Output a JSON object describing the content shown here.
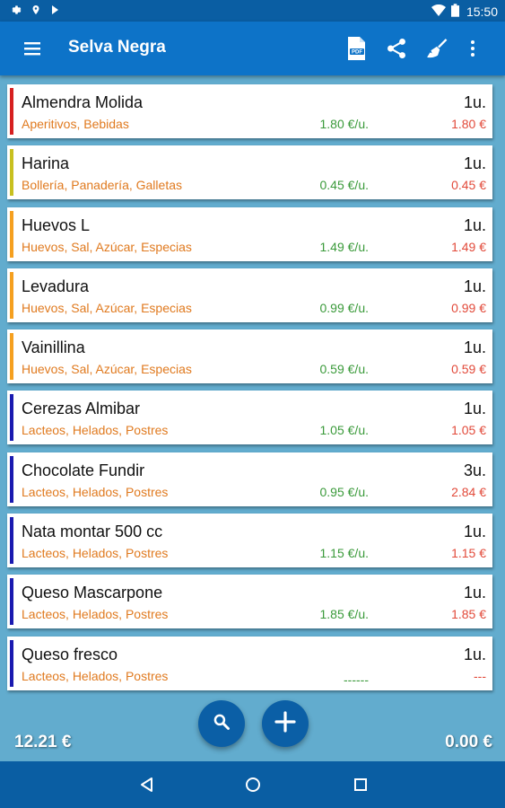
{
  "status_bar": {
    "time": "15:50",
    "icons": [
      "settings-gear-icon",
      "location-icon",
      "play-store-icon",
      "wifi-icon",
      "battery-icon"
    ]
  },
  "app_bar": {
    "title": "Selva Negra",
    "actions": [
      "pdf-icon",
      "share-icon",
      "broom-clean-icon",
      "more-vert-icon"
    ]
  },
  "items": [
    {
      "name": "Almendra Molida",
      "categories": "Aperitivos, Bebidas",
      "unit_price": "1.80 €/u.",
      "quantity": "1u.",
      "total": "1.80 €",
      "color": "#d62020"
    },
    {
      "name": "Harina",
      "categories": "Bollería, Panadería, Galletas",
      "unit_price": "0.45 €/u.",
      "quantity": "1u.",
      "total": "0.45 €",
      "color": "#c8c020"
    },
    {
      "name": "Huevos L",
      "categories": "Huevos, Sal, Azúcar, Especias",
      "unit_price": "1.49 €/u.",
      "quantity": "1u.",
      "total": "1.49 €",
      "color": "#f5a020"
    },
    {
      "name": "Levadura",
      "categories": "Huevos, Sal, Azúcar, Especias",
      "unit_price": "0.99 €/u.",
      "quantity": "1u.",
      "total": "0.99 €",
      "color": "#f5a020"
    },
    {
      "name": "Vainillina",
      "categories": "Huevos, Sal, Azúcar, Especias",
      "unit_price": "0.59 €/u.",
      "quantity": "1u.",
      "total": "0.59 €",
      "color": "#f5a020"
    },
    {
      "name": "Cerezas Almibar",
      "categories": "Lacteos, Helados, Postres",
      "unit_price": "1.05 €/u.",
      "quantity": "1u.",
      "total": "1.05 €",
      "color": "#1a1ab0"
    },
    {
      "name": "Chocolate Fundir",
      "categories": "Lacteos, Helados, Postres",
      "unit_price": "0.95 €/u.",
      "quantity": "3u.",
      "total": "2.84 €",
      "color": "#1a1ab0"
    },
    {
      "name": "Nata montar 500 cc",
      "categories": "Lacteos, Helados, Postres",
      "unit_price": "1.15 €/u.",
      "quantity": "1u.",
      "total": "1.15 €",
      "color": "#1a1ab0"
    },
    {
      "name": "Queso Mascarpone",
      "categories": "Lacteos, Helados, Postres",
      "unit_price": "1.85 €/u.",
      "quantity": "1u.",
      "total": "1.85 €",
      "color": "#1a1ab0"
    },
    {
      "name": "Queso fresco",
      "categories": "Lacteos, Helados, Postres",
      "unit_price": "------",
      "quantity": "1u.",
      "total": "---",
      "color": "#1a1ab0"
    }
  ],
  "footer": {
    "total_left": "12.21 €",
    "total_right": "0.00 €",
    "fab_search_icon": "search-icon",
    "fab_add_icon": "add-icon"
  },
  "nav_bar": {
    "icons": [
      "back-icon",
      "home-icon",
      "recents-icon"
    ]
  }
}
